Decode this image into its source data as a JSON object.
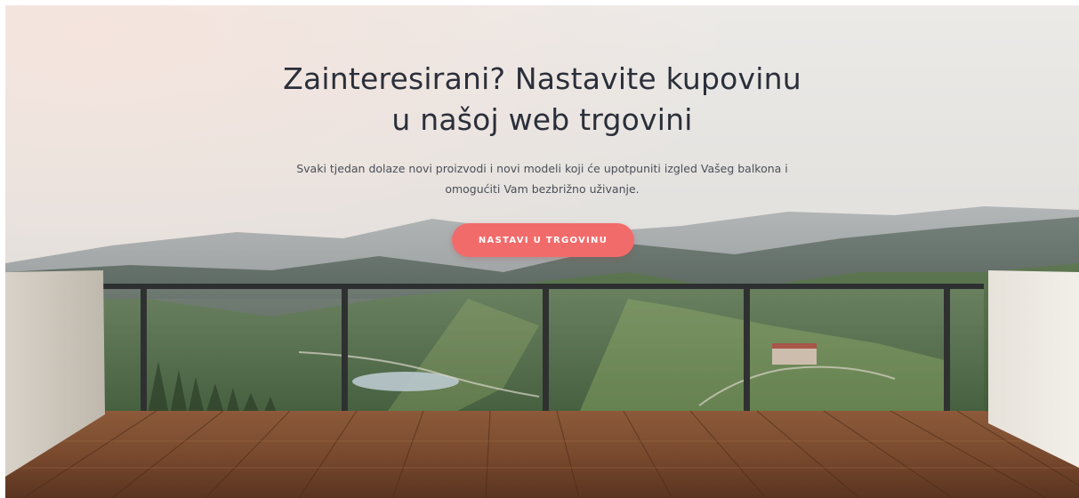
{
  "hero": {
    "title_line1": "Zainteresirani? Nastavite kupovinu",
    "title_line2": "u našoj web trgovini",
    "description_line1": "Svaki tjedan dolaze novi proizvodi i novi modeli koji će upotpuniti izgled Vašeg balkona i",
    "description_line2": "omogućiti Vam bezbrižno uživanje.",
    "cta_label": "NASTAVI U TRGOVINU",
    "colors": {
      "cta_background": "#f26b6b",
      "title_text": "#2b2f3a",
      "description_text": "#4a4f58"
    }
  }
}
